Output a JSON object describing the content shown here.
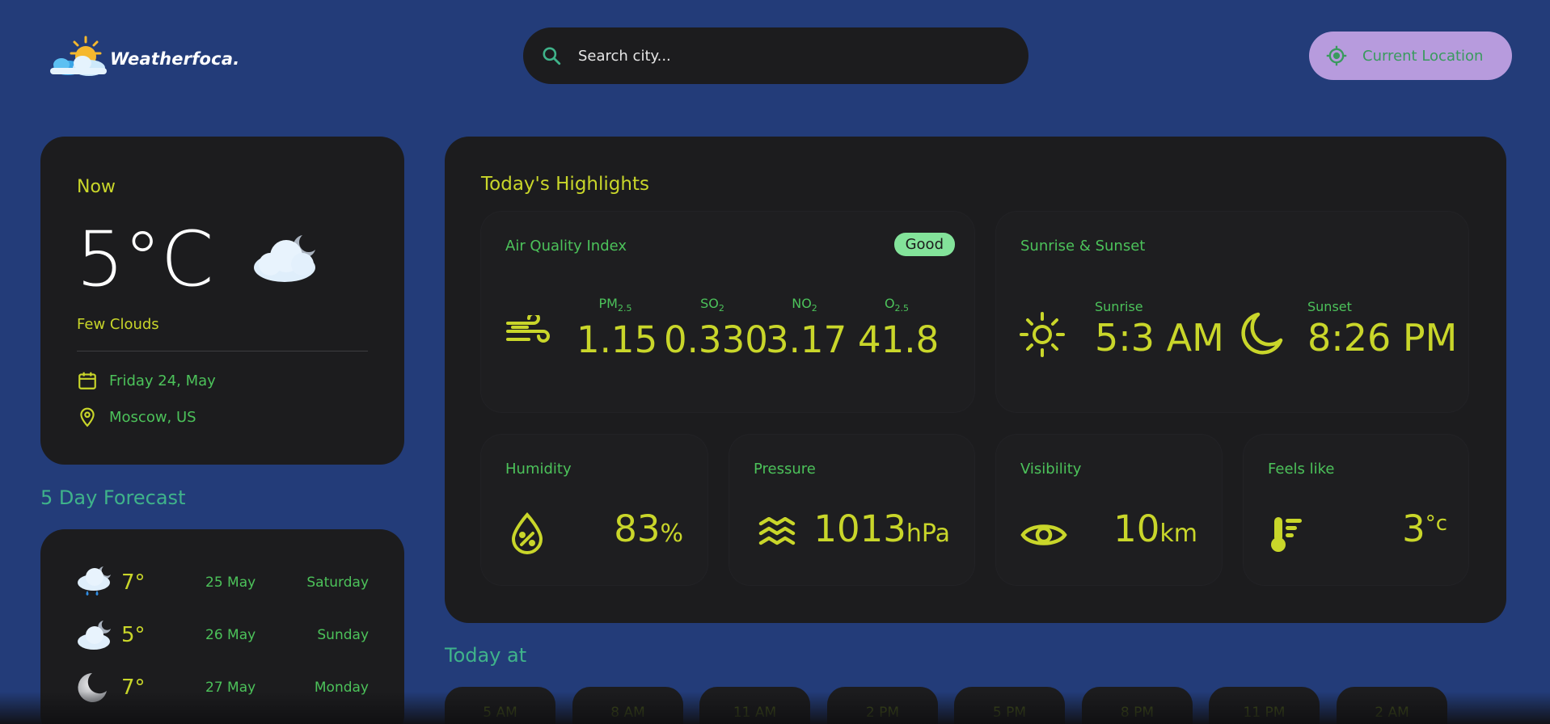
{
  "app": {
    "name": "Weatherfoca."
  },
  "search": {
    "placeholder": "Search city..."
  },
  "location_button": {
    "label": "Current Location"
  },
  "now": {
    "label": "Now",
    "temperature": "5°C",
    "condition": "Few Clouds",
    "date": "Friday 24, May",
    "location": "Moscow, US",
    "icon": "cloudy-night-icon"
  },
  "forecast": {
    "title": "5 Day Forecast",
    "days": [
      {
        "temp": "7°",
        "date": "25 May",
        "day": "Saturday",
        "icon": "rainy-cloud-icon"
      },
      {
        "temp": "5°",
        "date": "26 May",
        "day": "Sunday",
        "icon": "cloudy-night-icon"
      },
      {
        "temp": "7°",
        "date": "27 May",
        "day": "Monday",
        "icon": "moon-icon"
      }
    ]
  },
  "highlights": {
    "title": "Today's Highlights",
    "air_quality": {
      "title": "Air Quality Index",
      "badge": "Good",
      "items": [
        {
          "label": "PM",
          "sub": "2.5",
          "value": "1.15"
        },
        {
          "label": "SO",
          "sub": "2",
          "value": "0.330"
        },
        {
          "label": "NO",
          "sub": "2",
          "value": "3.17"
        },
        {
          "label": "O",
          "sub": "2.5",
          "value": "41.8"
        }
      ]
    },
    "sun": {
      "title": "Sunrise & Sunset",
      "sunrise_label": "Sunrise",
      "sunrise": "5:3 AM",
      "sunset_label": "Sunset",
      "sunset": "8:26 PM"
    },
    "humidity": {
      "title": "Humidity",
      "value": "83",
      "unit": "%"
    },
    "pressure": {
      "title": "Pressure",
      "value": "1013",
      "unit": "hPa"
    },
    "visibility": {
      "title": "Visibility",
      "value": "10",
      "unit": "km"
    },
    "feels_like": {
      "title": "Feels like",
      "value": "3",
      "unit": "°c"
    }
  },
  "today": {
    "title": "Today at",
    "hours": [
      "5 AM",
      "8 AM",
      "11 AM",
      "2 PM",
      "5 PM",
      "8 PM",
      "11 PM",
      "2 AM"
    ]
  },
  "colors": {
    "background": "#233c79",
    "card": "#1c1c1e",
    "accent_yellow": "#c9d62a",
    "accent_green": "#4cc25a",
    "location_button": "#b79bdd",
    "good_badge": "#83e39a"
  }
}
